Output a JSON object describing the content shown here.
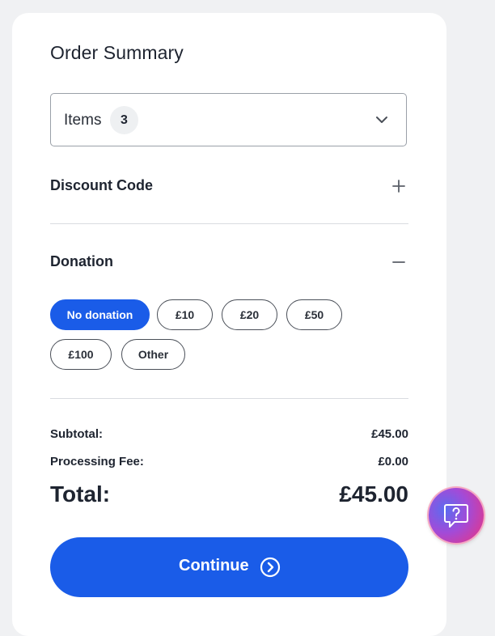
{
  "order": {
    "title": "Order Summary",
    "items_label": "Items",
    "items_count": "3",
    "discount_label": "Discount Code",
    "donation_label": "Donation"
  },
  "donation_options": [
    {
      "label": "No donation",
      "selected": true
    },
    {
      "label": "£10",
      "selected": false
    },
    {
      "label": "£20",
      "selected": false
    },
    {
      "label": "£50",
      "selected": false
    },
    {
      "label": "£100",
      "selected": false
    },
    {
      "label": "Other",
      "selected": false
    }
  ],
  "summary": {
    "subtotal_label": "Subtotal:",
    "subtotal_value": "£45.00",
    "fee_label": "Processing Fee:",
    "fee_value": "£0.00",
    "total_label": "Total:",
    "total_value": "£45.00"
  },
  "actions": {
    "continue_label": "Continue"
  },
  "icons": {
    "items_toggle": "chevron-down-icon",
    "discount_toggle": "plus-icon",
    "donation_toggle": "minus-icon",
    "continue": "arrow-right-circle-icon",
    "help": "help-chat-icon"
  },
  "colors": {
    "accent": "#1a5ce8",
    "text": "#1e2430",
    "background": "#f0f1f3",
    "card": "#ffffff"
  }
}
